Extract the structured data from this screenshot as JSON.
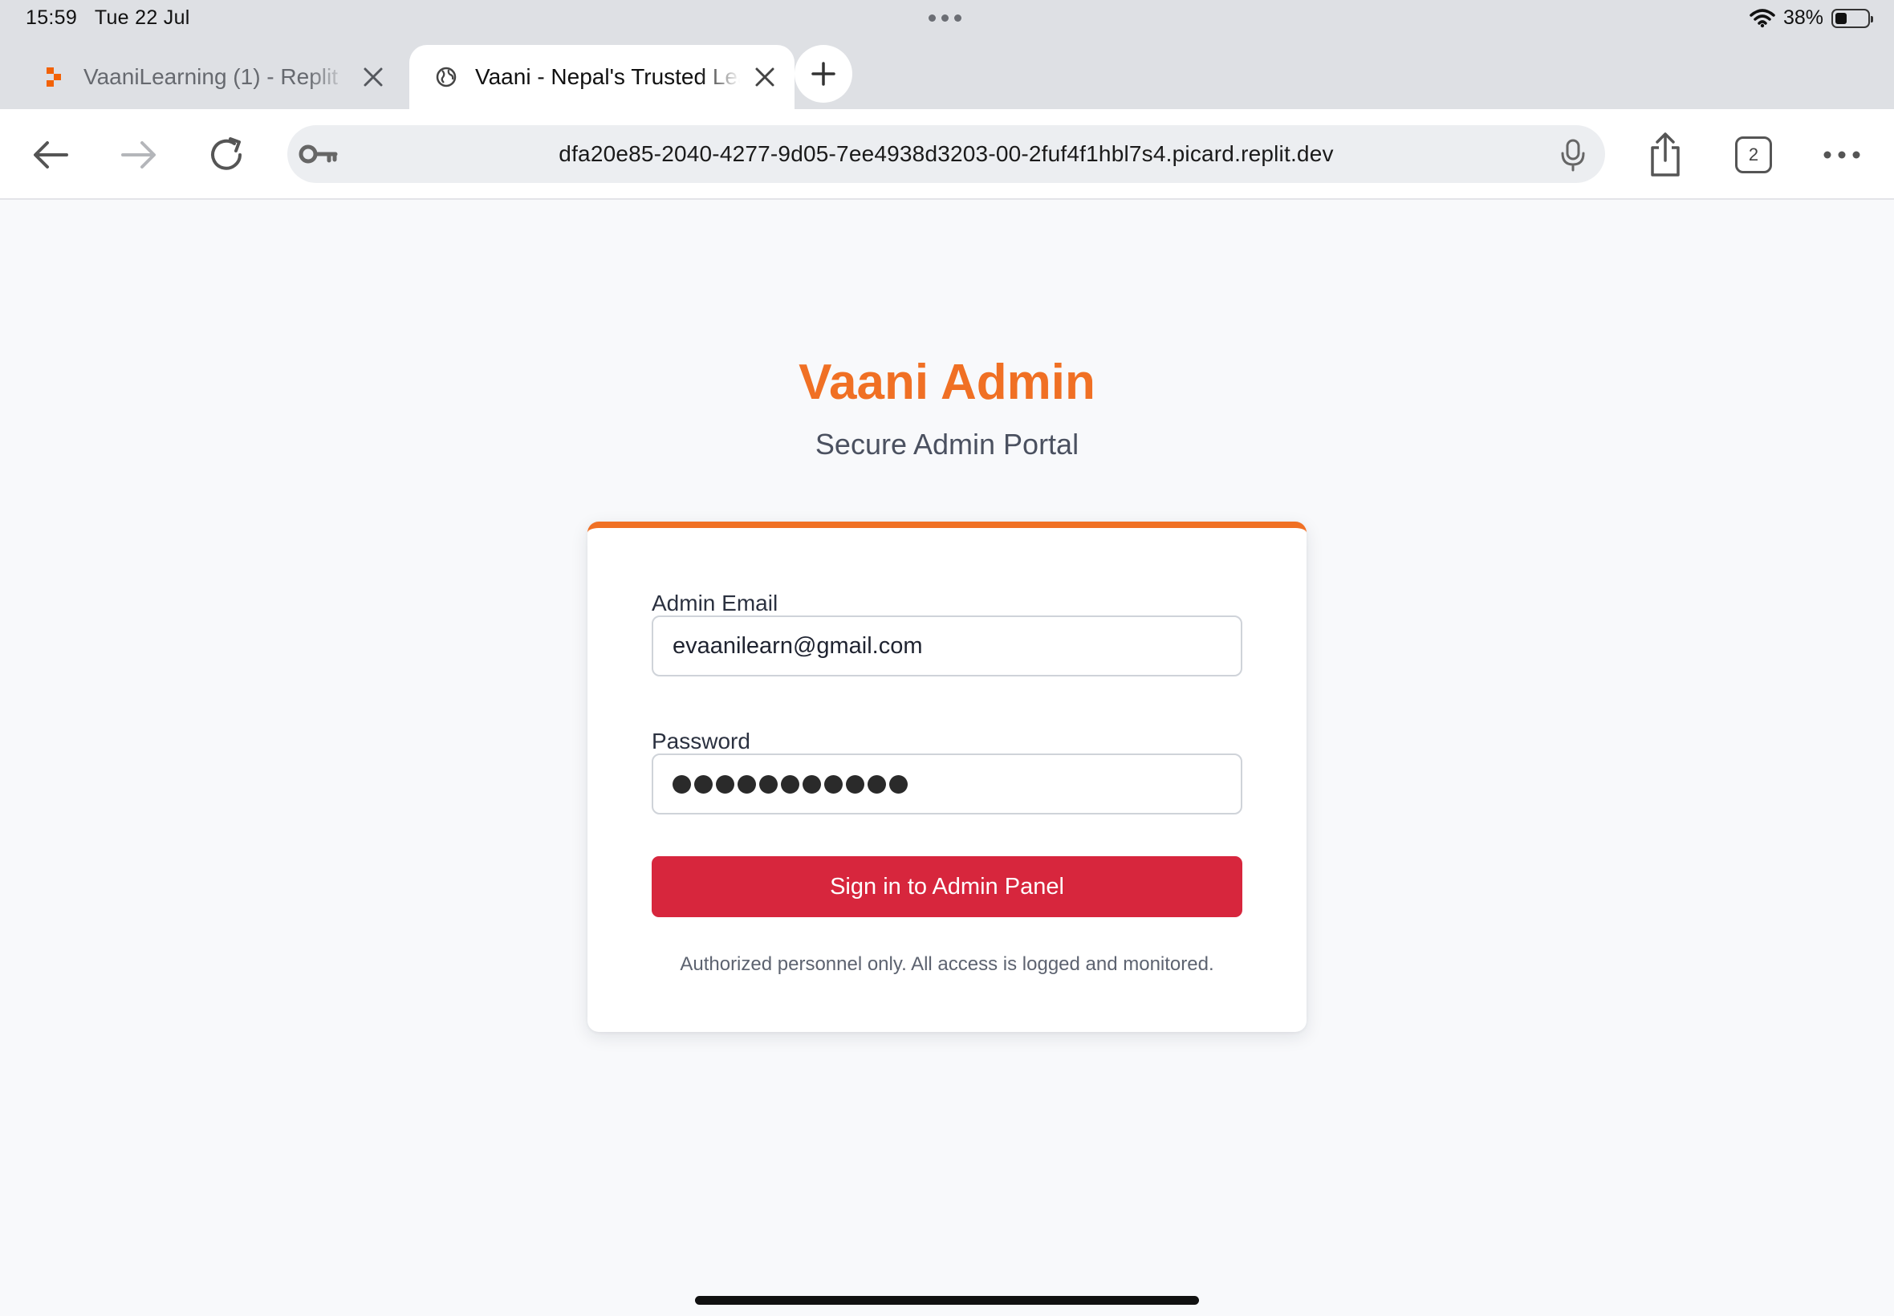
{
  "status_bar": {
    "time": "15:59",
    "date": "Tue 22 Jul",
    "battery_percent": "38%",
    "battery_level": 0.38,
    "icons": [
      "more-dots-icon",
      "wifi-icon",
      "battery-icon"
    ]
  },
  "tabs": [
    {
      "title": "VaaniLearning (1) - Replit",
      "favicon": "replit-icon",
      "active": false
    },
    {
      "title": "Vaani - Nepal's Trusted Learning",
      "favicon": "globe-icon",
      "active": true
    }
  ],
  "toolbar": {
    "url": "dfa20e85-2040-4277-9d05-7ee4938d3203-00-2fuf4f1hbl7s4.picard.replit.dev",
    "tab_count": "2",
    "icons": [
      "back-icon",
      "forward-icon",
      "reload-icon",
      "key-icon",
      "microphone-icon",
      "share-icon",
      "tabs-icon",
      "more-icon"
    ]
  },
  "login": {
    "title": "Vaani Admin",
    "subtitle": "Secure Admin Portal",
    "email_label": "Admin Email",
    "email_value": "evaanilearn@gmail.com",
    "password_label": "Password",
    "password_length": 11,
    "submit_label": "Sign in to Admin Panel",
    "disclaimer": "Authorized personnel only. All access is logged and monitored."
  },
  "colors": {
    "accent": "#f07024",
    "submit": "#d7263d",
    "page_background": "#f8f9fb",
    "chrome_background": "#dee0e4"
  }
}
